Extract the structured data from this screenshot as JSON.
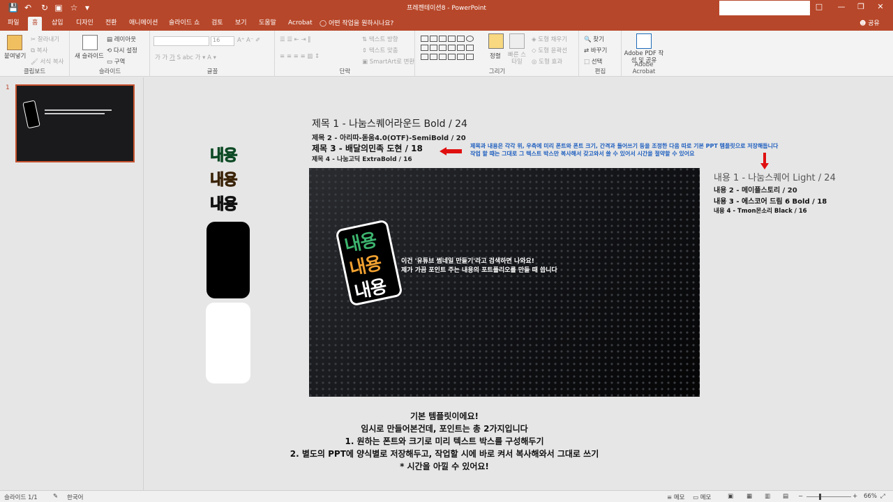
{
  "app": {
    "title": "프레젠테이션8 - PowerPoint",
    "share": "공유",
    "tell_me": "어떤 작업을 원하시나요?"
  },
  "tabs": [
    "파일",
    "홈",
    "삽입",
    "디자인",
    "전환",
    "애니메이션",
    "슬라이드 쇼",
    "검토",
    "보기",
    "도움말",
    "Acrobat"
  ],
  "ribbon": {
    "clipboard": {
      "label": "클립보드",
      "paste": "붙여넣기",
      "cut": "잘라내기",
      "copy": "복사",
      "format_painter": "서식 복사"
    },
    "slides": {
      "label": "슬라이드",
      "new_slide": "새 슬라이드",
      "layout": "레이아웃",
      "reset": "다시 설정",
      "section": "구역"
    },
    "font": {
      "label": "글꼴",
      "size": "16"
    },
    "paragraph": {
      "label": "단락",
      "text_direction": "텍스트 방향",
      "align_text": "텍스트 맞춤",
      "smartart": "SmartArt로 변환"
    },
    "drawing": {
      "label": "그리기",
      "arrange": "정렬",
      "quick_styles": "빠른 스타일",
      "fill": "도형 채우기",
      "outline": "도형 윤곽선",
      "effects": "도형 효과"
    },
    "editing": {
      "label": "편집",
      "find": "찾기",
      "replace": "바꾸기",
      "select": "선택"
    },
    "acrobat": {
      "label": "Adobe Acrobat",
      "create_pdf": "Adobe PDF 작성 및 공유"
    }
  },
  "slide_panel": {
    "number": "1"
  },
  "slide": {
    "titles": [
      "제목 1 - 나눔스퀘어라운드 Bold / 24",
      "제목 2 - 아리따-돋움4.0(OTF)-SemiBold / 20",
      "제목 3 - 배달의민족 도현 / 18",
      "제목 4 - 나눔고딕 ExtraBold / 16"
    ],
    "note_lines": [
      "제목과 내용은 각각 위, 우측에 미리 폰트와 폰트 크기, 간격과 들어쓰기 등을 조정한 다음 따로 기본 PPT 템플릿으로 저장해둡니다",
      "작업 할 때는 그대로 그 텍스트 박스만 복사해서 갖고와서 쓸 수 있어서 시간을 절약할 수 있어요"
    ],
    "contents": [
      "내용 1 - 나눔스퀘어 Light / 24",
      "내용 2 - 메이플스토리 / 20",
      "내용 3 - 에스코어 드림 6 Bold / 18",
      "내용 4 - Tmon몬소리 Black / 16"
    ],
    "sample_word": "내용",
    "main_text": [
      "이건 '유튜브 썸네일 만들기'라고 검색하면 나와요!",
      "제가 가끔 포인트 주는 내용의 포트폴리오를 만들 때 씁니다"
    ],
    "bottom_text": [
      "기본 템플릿이에요!",
      "임시로 만들어본건데, 포인트는 총 2가지입니다",
      "1.   원하는 폰트와 크기로 미리 텍스트 박스를 구성해두기",
      "2. 별도의 PPT에 양식별로 저장해두고, 작업할 시에 바로 켜서 복사해와서 그대로 쓰기",
      "* 시간을 아낄 수 있어요!"
    ]
  },
  "status": {
    "slide": "슬라이드 1/1",
    "language": "한국어",
    "notes": "메모",
    "comments": "메모",
    "zoom": "66%"
  },
  "colors": {
    "accent": "#b7472a",
    "green": "#3cb46e",
    "orange": "#f0a030",
    "note_blue": "#1f5fbf",
    "arrow_red": "#e01010"
  }
}
